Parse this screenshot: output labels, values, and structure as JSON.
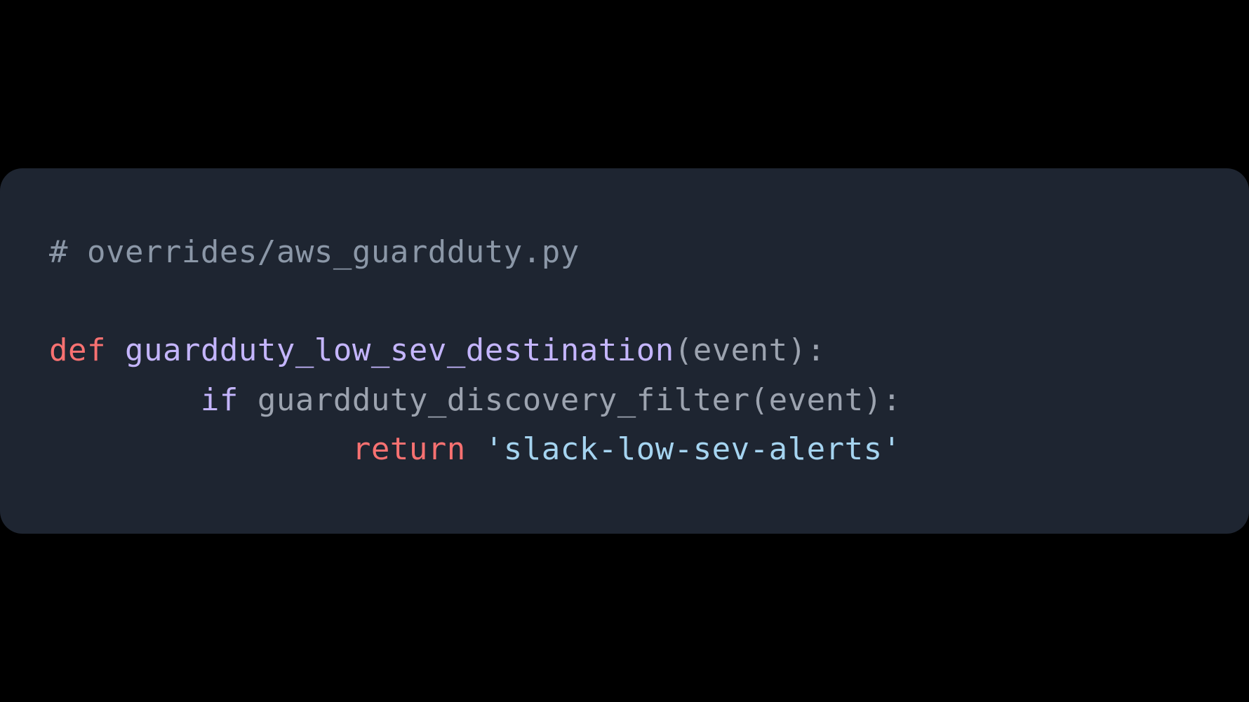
{
  "code": {
    "comment": "# overrides/aws_guardduty.py",
    "def_keyword": "def",
    "function_name": "guardduty_low_sev_destination",
    "open_paren1": "(",
    "param1": "event",
    "close_paren1": ")",
    "colon1": ":",
    "indent2": "        ",
    "if_keyword": "if",
    "filter_func": "guardduty_discovery_filter",
    "open_paren2": "(",
    "param2": "event",
    "close_paren2": ")",
    "colon2": ":",
    "indent3": "                ",
    "return_keyword": "return",
    "string_literal": "'slack-low-sev-alerts'"
  }
}
